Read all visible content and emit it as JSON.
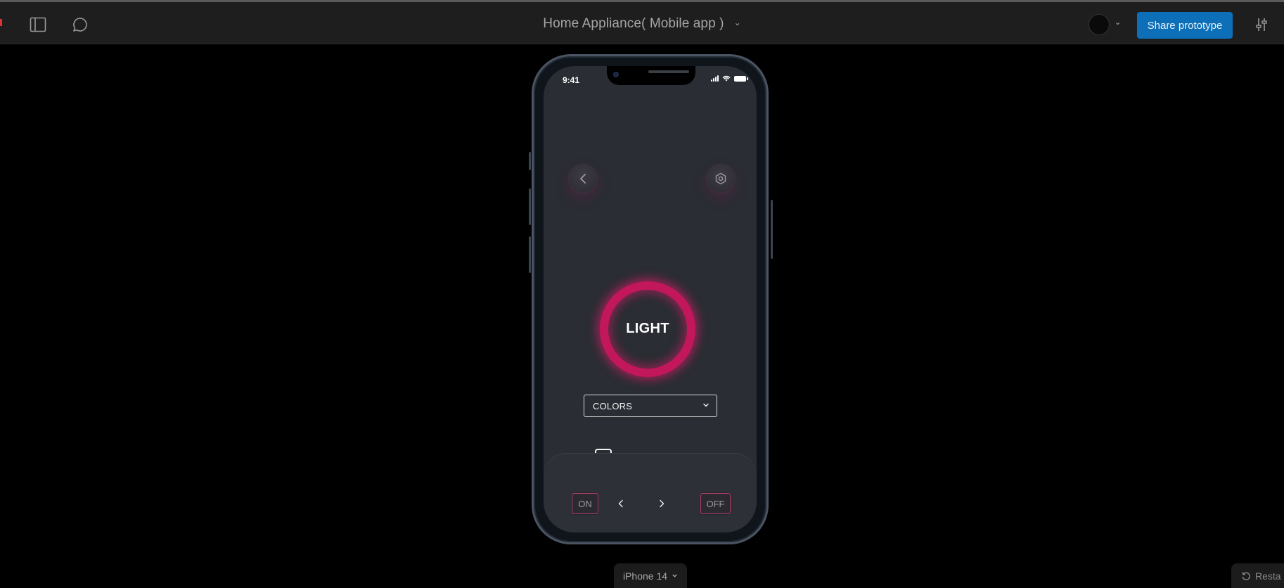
{
  "toolbar": {
    "title": "Home Appliance( Mobile app )",
    "share_label": "Share prototype",
    "icons": [
      "sidebar-toggle-icon",
      "comment-icon",
      "chevron-down-icon",
      "settings-sliders-icon"
    ]
  },
  "phone": {
    "status": {
      "time": "9:41"
    },
    "main_label": "LIGHT",
    "dropdown": {
      "selected": "COLORS"
    },
    "slider": {
      "value_fraction": 0.0
    },
    "controls": {
      "on_label": "ON",
      "off_label": "OFF"
    },
    "accent_color": "#c2185b"
  },
  "footer": {
    "device": "iPhone 14",
    "restart_label": "Resta"
  }
}
